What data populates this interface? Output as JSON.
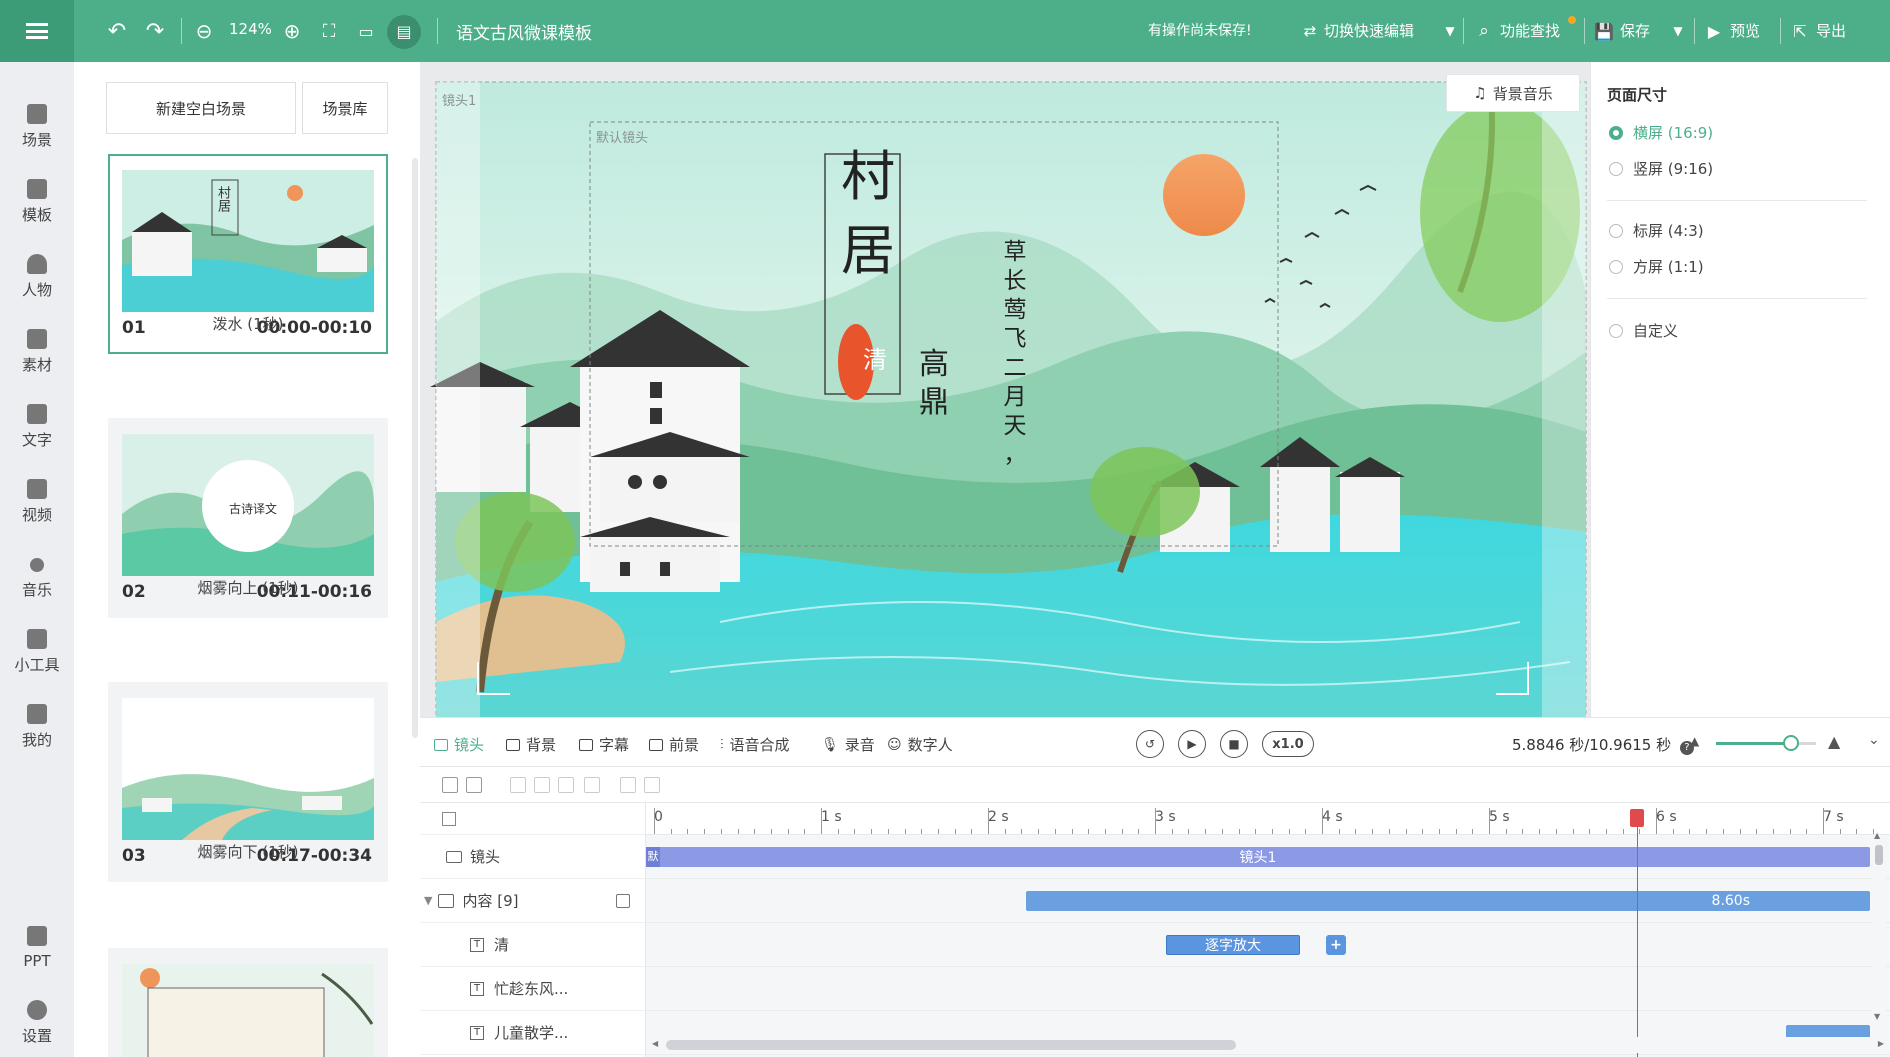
{
  "topbar": {
    "project_title": "语文古风微课模板",
    "zoom_level": "124%",
    "unsaved_notice": "有操作尚未保存!",
    "quick_edit_label": "切换快速编辑",
    "find_label": "功能查找",
    "save_label": "保存",
    "preview_label": "预览",
    "export_label": "导出"
  },
  "leftnav": {
    "items": [
      {
        "label": "场景",
        "icon": "scene-icon"
      },
      {
        "label": "模板",
        "icon": "template-icon"
      },
      {
        "label": "人物",
        "icon": "person-icon"
      },
      {
        "label": "素材",
        "icon": "material-icon"
      },
      {
        "label": "文字",
        "icon": "text-icon"
      },
      {
        "label": "视频",
        "icon": "video-icon"
      },
      {
        "label": "音乐",
        "icon": "music-icon"
      },
      {
        "label": "小工具",
        "icon": "toolbox-icon"
      },
      {
        "label": "我的",
        "icon": "upload-icon"
      },
      {
        "label": "PPT",
        "icon": "ppt-icon"
      },
      {
        "label": "设置",
        "icon": "gear-icon"
      }
    ]
  },
  "scenes": {
    "new_blank_label": "新建空白场景",
    "library_label": "场景库",
    "cards": [
      {
        "num": "01",
        "time": "00:00-00:10",
        "transition": "泼水 (1秒)",
        "thumb_title": "村居"
      },
      {
        "num": "02",
        "time": "00:11-00:16",
        "transition": "烟雾向上 (1秒)",
        "thumb_title": "古诗译文"
      },
      {
        "num": "03",
        "time": "00:17-00:34",
        "transition": "烟雾向下 (1秒)",
        "thumb_title": ""
      }
    ]
  },
  "stage": {
    "lens_tag": "镜头1",
    "default_lens_tag": "默认镜头",
    "bgm_label": "背景音乐",
    "poem_title": [
      "村",
      "居"
    ],
    "seal_char": "清",
    "author": [
      "高",
      "鼎"
    ],
    "poem_line": [
      "草",
      "长",
      "莺",
      "飞",
      "二",
      "月",
      "天",
      "，"
    ]
  },
  "page_size": {
    "title": "页面尺寸",
    "options": [
      {
        "label": "横屏 (16:9)",
        "selected": true
      },
      {
        "label": "竖屏 (9:16)",
        "selected": false
      },
      {
        "label": "标屏 (4:3)",
        "selected": false
      },
      {
        "label": "方屏 (1:1)",
        "selected": false
      },
      {
        "label": "自定义",
        "selected": false
      }
    ]
  },
  "playbar": {
    "tabs": [
      "镜头",
      "背景",
      "字幕",
      "前景",
      "语音合成",
      "录音",
      "数字人"
    ],
    "speed": "x1.0",
    "time_readout": "5.8846 秒/10.9615 秒",
    "zoom_fraction": 0.75
  },
  "timeline": {
    "ruler": [
      "0",
      "1 s",
      "2 s",
      "3 s",
      "4 s",
      "5 s",
      "6 s",
      "7 s"
    ],
    "rows": [
      {
        "label": "镜头",
        "icon": "camera-icon"
      },
      {
        "label": "内容 [9]",
        "icon": "content-icon"
      },
      {
        "label": "清",
        "icon": "text-t-icon"
      },
      {
        "label": "忙趁东风...",
        "icon": "text-t-icon"
      },
      {
        "label": "儿童散学...",
        "icon": "text-t-icon"
      }
    ],
    "lens_clip_start_tag": "默",
    "lens_clip_label": "镜头1",
    "content_clip_label": "8.60s",
    "effect_clip_label": "逐字放大",
    "add_effect_label": "+",
    "playhead_seconds": 5.8846,
    "colors": {
      "lens_clip": "#8c9ae6",
      "content_clip": "#6a9fe0",
      "effect_clip": "#5b95e0",
      "playhead": "#e04a4a",
      "accent": "#4caf8a"
    }
  }
}
